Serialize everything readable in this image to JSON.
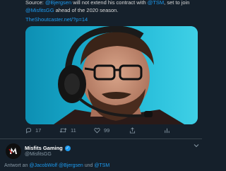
{
  "tweet": {
    "line1_prefix": "Source: ",
    "line1_mention1": "@Bjergsen",
    "line1_middle": " will not extend his contract with ",
    "line1_mention2": "@TSM",
    "line1_suffix": ", set to join",
    "line2_mention": "@MisfitsGG",
    "line2_suffix": " ahead of the 2020 season.",
    "link": "TheShoutcaster.net/?p=14"
  },
  "actions": {
    "reply_count": "17",
    "retweet_count": "11",
    "like_count": "99",
    "icons": [
      "reply-icon",
      "retweet-icon",
      "like-icon",
      "share-icon",
      "analytics-icon"
    ]
  },
  "reply": {
    "author_name": "Misfits Gaming",
    "author_handle": "@MisfitsGG",
    "reply_prefix": "Antwort an ",
    "reply_mention1": "@JacobWolf",
    "reply_sep1": " @Bjergsen",
    "reply_und": " und ",
    "reply_mention3": "@TSM"
  },
  "colors": {
    "background": "#15202b",
    "link": "#1d9bf0",
    "muted": "#8899a6"
  }
}
